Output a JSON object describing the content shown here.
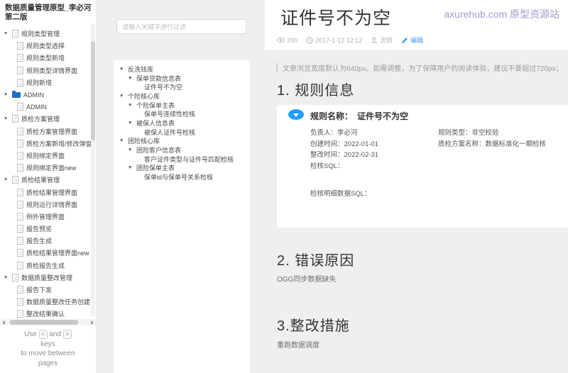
{
  "sidebar": {
    "title": "数据质量管理原型_李必河第二版",
    "tree": [
      {
        "label": "规则类型管理"
      },
      {
        "label": "规则类型选择"
      },
      {
        "label": "规则类型新增"
      },
      {
        "label": "规则类型详情界面"
      },
      {
        "label": "规则新增"
      },
      {
        "label": "ADMIN"
      },
      {
        "label": "ADMIN"
      },
      {
        "label": "质检方案管理"
      },
      {
        "label": "质检方案管理界面"
      },
      {
        "label": "质检方案新增/修改弹窗"
      },
      {
        "label": "规则绑定界面"
      },
      {
        "label": "规则绑定界面new"
      },
      {
        "label": "质检结果管理"
      },
      {
        "label": "质检结果管理界面"
      },
      {
        "label": "规则运行详情界面"
      },
      {
        "label": "例外管理界面"
      },
      {
        "label": "报告预览"
      },
      {
        "label": "报告生成"
      },
      {
        "label": "质检结果管理界面new"
      },
      {
        "label": "质检报告生成"
      },
      {
        "label": "数据质量整改管理"
      },
      {
        "label": "报告下发"
      },
      {
        "label": "数据质量整改任务创建"
      },
      {
        "label": "整改结果确认"
      }
    ],
    "footer": {
      "use": "Use",
      "and": "and",
      "key_left": "<",
      "key_right": ">",
      "keys_line": "keys",
      "move_line": "to move between",
      "pages_line": "pages"
    }
  },
  "filter": {
    "placeholder": "请输入关键字进行过滤",
    "tree": [
      {
        "label": "反洗钱库"
      },
      {
        "label": "保单贷款信息表"
      },
      {
        "label": "证件号不为空"
      },
      {
        "label": "个险核心库"
      },
      {
        "label": "个险保单主表"
      },
      {
        "label": "保单号连续性检核"
      },
      {
        "label": "被保人信息表"
      },
      {
        "label": "被保人证件号检核"
      },
      {
        "label": "团险核心库"
      },
      {
        "label": "团险客户信息表"
      },
      {
        "label": "客户证件类型与证件号匹配检核"
      },
      {
        "label": "团险保单主表"
      },
      {
        "label": "保单id与保单号关系检核"
      }
    ]
  },
  "doc": {
    "title": "证件号不为空",
    "watermark": "axurehub.com 原型资源站",
    "meta": {
      "views": "200",
      "datetime": "2017-1-12 12:12",
      "author": "流转",
      "edit_label": "编辑"
    },
    "notice": "文章浏览宽度默认为640px。如需调整，为了保障用户的阅读体验，建议不要超过720px；",
    "section1": {
      "heading": "1. 规则信息"
    },
    "card": {
      "name_label": "规则名称：",
      "name_value": "证件号不为空",
      "owner": "负责人：李必河",
      "created": "创建时间：2022-01-01",
      "rectified": "整改时间：2022-02-31",
      "check_sql": "检核SQL：",
      "rule_type": "规则类型：非空校验",
      "plan_name": "质检方案名称：数据标准化一期检核",
      "detail_sql": "检核明细数据SQL："
    },
    "section2": {
      "heading": "2. 错误原因",
      "body": "OGG同步数据缺失"
    },
    "section3": {
      "heading": "3.整改措施",
      "body": "重跑数据调度"
    }
  },
  "colors": {
    "accent_blue": "#1e9ffb",
    "link_blue": "#3d9df2",
    "folder_blue": "#1f6ec2",
    "watermark_purple": "#a79ace",
    "page_bg": "#efefef"
  }
}
